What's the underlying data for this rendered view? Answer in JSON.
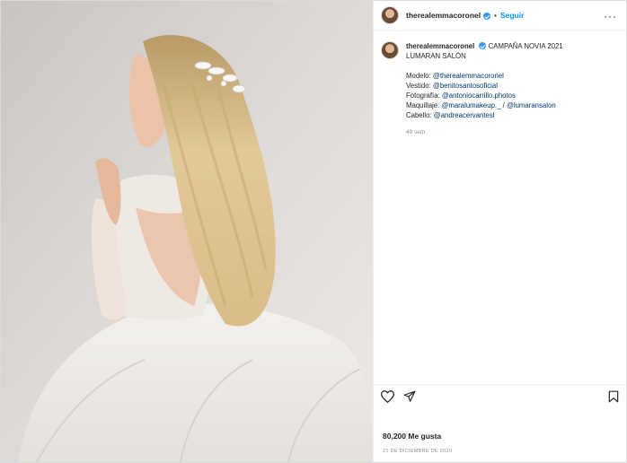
{
  "post": {
    "username": "therealemmacoronel",
    "follow_label": "Seguir",
    "separator": "•"
  },
  "caption": {
    "username": "therealemmacoronel",
    "title": "CAMPAÑA NOVIA 2021",
    "subtitle": "LUMARAN SALÓN",
    "credits": [
      {
        "label": "Modelo: ",
        "mention": "@therealemmacoronel"
      },
      {
        "label": "Vestido: ",
        "mention": "@benitosantosoficial"
      },
      {
        "label": "Fotografía: ",
        "mention": "@antoniocarrillo.photos"
      },
      {
        "label": "Maquillaje: ",
        "mention": "@maralumakeup._",
        "extra": " / ",
        "mention2": "@lumaransalon"
      },
      {
        "label": "Cabello: ",
        "mention": "@andreacervantesl"
      }
    ],
    "time_ago": "49 sem"
  },
  "footer": {
    "likes": "80,200 Me gusta",
    "date": "21 DE DICIEMBRE DE 2020"
  },
  "colors": {
    "link": "#0095f6",
    "mention": "#00376b",
    "verified": "#3897f0",
    "muted": "#8e8e8e"
  },
  "icons": [
    "more-options-icon",
    "verified-badge-icon",
    "heart-icon",
    "share-icon",
    "bookmark-icon"
  ]
}
